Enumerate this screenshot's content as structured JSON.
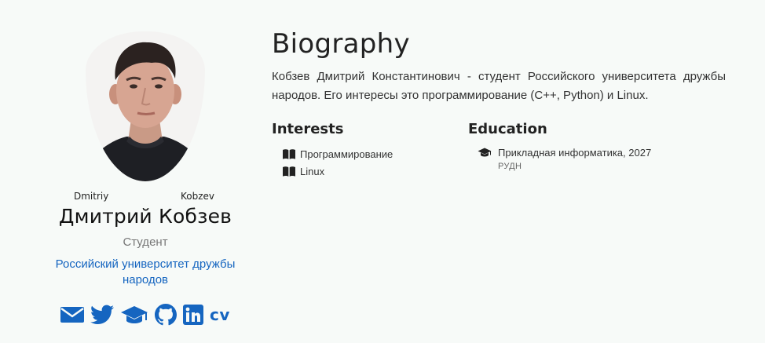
{
  "profile": {
    "avatar_alt": "avatar",
    "given_name": "Dmitriy",
    "family_name": "Kobzev",
    "full_name": "Дмитрий Кобзев",
    "role": "Студент",
    "organization": "Российский университет дружбы народов",
    "social_icons": [
      "envelope-icon",
      "twitter-icon",
      "graduation-cap-icon",
      "github-icon",
      "linkedin-icon",
      "cv-icon"
    ],
    "cv_label": "cv"
  },
  "biography": {
    "heading": "Biography",
    "text": "Кобзев Дмитрий Константинович - студент Российского университета дружбы народов. Его интересы это программирование (C++, Python) и Linux."
  },
  "interests": {
    "heading": "Interests",
    "items": [
      "Программирование",
      "Linux"
    ]
  },
  "education": {
    "heading": "Education",
    "items": [
      {
        "title": "Прикладная информатика, 2027",
        "institution": "РУДН"
      }
    ]
  },
  "colors": {
    "background": "#f7faf8",
    "accent": "#1565c0",
    "muted": "#777777"
  }
}
